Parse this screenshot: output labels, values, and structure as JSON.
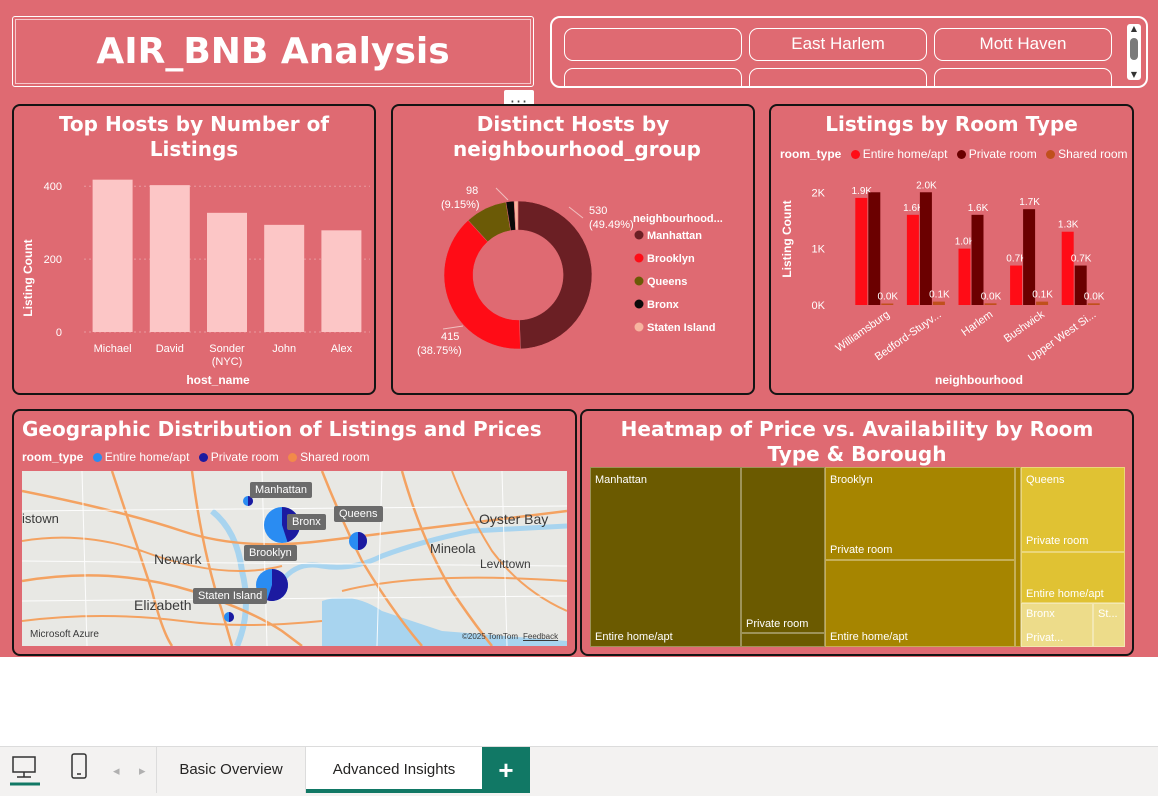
{
  "header": {
    "title": "AIR_BNB Analysis",
    "more_label": "···"
  },
  "slicer": {
    "items": [
      "",
      "East Harlem",
      "Mott Haven",
      "",
      "",
      ""
    ]
  },
  "hosts_chart": {
    "title": "Top Hosts by Number of Listings",
    "chart_data": {
      "type": "bar",
      "categories": [
        "Michael",
        "David",
        "Sonder (NYC)",
        "John",
        "Alex"
      ],
      "values": [
        418,
        403,
        327,
        294,
        279
      ],
      "ylabel": "Listing Count",
      "xlabel": "host_name",
      "yticks": [
        "0",
        "200",
        "400"
      ],
      "ylim": [
        0,
        450
      ],
      "color": "#fcc6c6"
    }
  },
  "donut_chart": {
    "title": "Distinct Hosts by neighbourhood_group",
    "chart_data": {
      "type": "pie",
      "legend_title": "neighbourhood...",
      "labels": [
        "Manhattan",
        "Brooklyn",
        "Queens",
        "Bronx",
        "Staten Island"
      ],
      "values": [
        530,
        415,
        98,
        19,
        9
      ],
      "colors": [
        "#6b1f24",
        "#ff0c16",
        "#6b5a06",
        "#0a0a0a",
        "#f7b5a0"
      ],
      "data_labels": [
        {
          "value": "530",
          "pct": "(49.49%)"
        },
        {
          "value": "415",
          "pct": "(38.75%)"
        },
        {
          "value": "98",
          "pct": "(9.15%)"
        }
      ]
    }
  },
  "room_chart": {
    "title": "Listings by Room Type",
    "chart_data": {
      "type": "bar",
      "legend_title": "room_type",
      "categories": [
        "Williamsburg",
        "Bedford-Stuyv...",
        "Harlem",
        "Bushwick",
        "Upper West Si..."
      ],
      "series": [
        {
          "name": "Entire home/apt",
          "color": "#ff0c16",
          "values": [
            1.9,
            1.6,
            1.0,
            0.7,
            1.3
          ],
          "labels": [
            "1.9K",
            "1.6K",
            "1.0K",
            "0.7K",
            "1.3K"
          ]
        },
        {
          "name": "Private room",
          "color": "#6b0000",
          "values": [
            2.0,
            2.0,
            1.6,
            1.7,
            0.7
          ],
          "labels": [
            "",
            "2.0K",
            "1.6K",
            "1.7K",
            "0.7K"
          ]
        },
        {
          "name": "Shared room",
          "color": "#c0501c",
          "values": [
            0.02,
            0.06,
            0.03,
            0.06,
            0.03
          ],
          "labels": [
            "0.0K",
            "0.1K",
            "0.0K",
            "0.1K",
            "0.0K"
          ]
        }
      ],
      "ylabel": "Listing Count",
      "xlabel": "neighbourhood",
      "yticks": [
        "0K",
        "1K",
        "2K"
      ],
      "ylim": [
        0,
        2.2
      ]
    }
  },
  "map_card": {
    "title": "Geographic Distribution of Listings and Prices",
    "legend_title": "room_type",
    "legend": [
      {
        "name": "Entire home/apt",
        "color": "#2a8cf2"
      },
      {
        "name": "Private room",
        "color": "#1c1aa0"
      },
      {
        "name": "Shared room",
        "color": "#f28a4a"
      }
    ],
    "labels": {
      "manhattan": "Manhattan",
      "bronx": "Bronx",
      "queens": "Queens",
      "brooklyn": "Brooklyn",
      "staten": "Staten Island"
    },
    "places": {
      "stown": "istown",
      "newark": "Newark",
      "elizabeth": "Elizabeth",
      "oyster": "Oyster Bay",
      "mineola": "Mineola",
      "levittown": "Levittown"
    },
    "shields": [
      "280",
      "21",
      "78",
      "95",
      "495",
      "678",
      "1"
    ],
    "footer": {
      "brand": "Microsoft Azure",
      "copyright": "©2025 TomTom",
      "feedback": "Feedback"
    }
  },
  "treemap_card": {
    "title": "Heatmap of Price vs. Availability by Room Type & Borough",
    "groups": {
      "manhattan": "Manhattan",
      "manhattan_entire": "Entire home/apt",
      "manhattan_private": "Private room",
      "brooklyn": "Brooklyn",
      "brooklyn_private": "Private room",
      "brooklyn_entire": "Entire home/apt",
      "queens": "Queens",
      "queens_private": "Private room",
      "queens_entire": "Entire home/apt",
      "bronx": "Bronx",
      "bronx_private": "Privat...",
      "staten": "St..."
    },
    "colors": {
      "manhattan": "#6b5a00",
      "brooklyn": "#a68500",
      "queens": "#e0c233",
      "small": "#eddc8a"
    }
  },
  "tabs": {
    "basic": "Basic Overview",
    "advanced": "Advanced Insights",
    "add": "+"
  }
}
